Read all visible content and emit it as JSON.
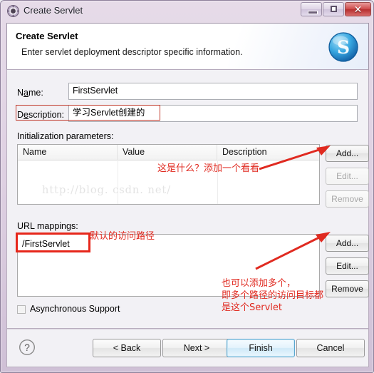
{
  "window": {
    "title": "Create Servlet",
    "icon": "servlet-gear-icon",
    "controls": {
      "minimize": "minimize-icon",
      "maximize": "restore-icon",
      "close": "✕"
    }
  },
  "header": {
    "title": "Create Servlet",
    "subtitle": "Enter servlet deployment descriptor specific information.",
    "logo": "servlet-s-logo"
  },
  "form": {
    "name_label": "Name:",
    "name_value": "FirstServlet",
    "description_label": "Description:",
    "description_value": "学习Servlet创建的"
  },
  "init_params": {
    "caption": "Initialization parameters:",
    "columns": [
      "Name",
      "Value",
      "Description"
    ],
    "rows": [],
    "buttons": [
      {
        "label": "Add...",
        "enabled": true
      },
      {
        "label": "Edit...",
        "enabled": false
      },
      {
        "label": "Remove",
        "enabled": false
      }
    ]
  },
  "url_mappings": {
    "caption": "URL mappings:",
    "rows": [
      "/FirstServlet"
    ],
    "buttons": [
      {
        "label": "Add...",
        "enabled": true
      },
      {
        "label": "Edit...",
        "enabled": true
      },
      {
        "label": "Remove",
        "enabled": true
      }
    ]
  },
  "async": {
    "label": "Asynchronous Support",
    "checked": false
  },
  "footer": {
    "help": "?",
    "back": "< Back",
    "next": "Next >",
    "finish": "Finish",
    "cancel": "Cancel"
  },
  "annotations": {
    "init_params_note": "这是什么？添加一个看看",
    "url_default_note": "默认的访问路径",
    "multi_note_line1": "也可以添加多个，",
    "multi_note_line2": "即多个路径的访问目标都",
    "multi_note_line3": "是这个Servlet"
  },
  "watermark": "http://blog. csdn. net/",
  "colors": {
    "annotation_red": "#e02a20",
    "title_purple": "#ded0e2",
    "finish_blue": "#5aa7cf"
  }
}
